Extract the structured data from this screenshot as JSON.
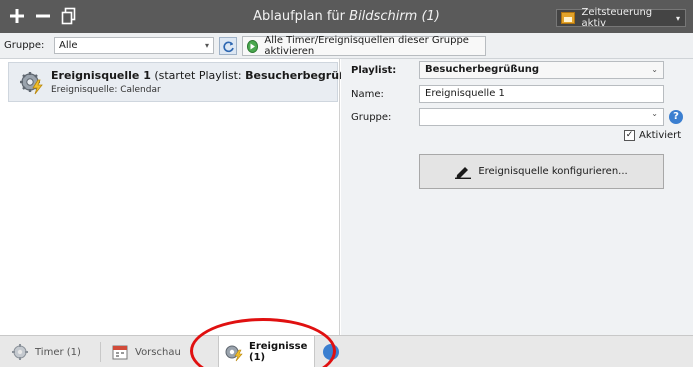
{
  "window": {
    "title_prefix": "Ablaufplan für ",
    "title_italic": "Bildschirm (1)",
    "time_control_label": "Zeitsteuerung aktiv",
    "time_control_arrow": "▾",
    "icons": [
      "plus-icon",
      "minus-icon",
      "copy-icon"
    ]
  },
  "toolbar": {
    "group_label": "Gruppe:",
    "group_value": "Alle",
    "activate_all_label": "Alle Timer/Ereignisquellen dieser Gruppe aktivieren"
  },
  "event_list": [
    {
      "name": "Ereignisquelle 1",
      "starts_text": " (startet Playlist: ",
      "playlist": "Besucherbegrüßung",
      "close_paren": ")",
      "source": "Ereignisquelle: Calendar"
    }
  ],
  "details": {
    "playlist_label": "Playlist:",
    "playlist_value": "Besucherbegrüßung",
    "name_label": "Name:",
    "name_value": "Ereignisquelle 1",
    "group_label": "Gruppe:",
    "group_value": "",
    "help_glyph": "?",
    "active_label": "Aktiviert",
    "active_checked": true,
    "configure_label": "Ereignisquelle konfigurieren..."
  },
  "tabs": [
    {
      "label": "Timer (1)",
      "icon": "gear-timer-icon",
      "active": false
    },
    {
      "label": "Vorschau",
      "icon": "calendar-icon",
      "active": false
    },
    {
      "label": "Ereignisse (1)",
      "icon": "gear-lightning-icon",
      "active": true
    }
  ],
  "colors": {
    "titlebar": "#5a5a5a",
    "highlight": "#e01010",
    "accent": "#3b7fd0"
  }
}
